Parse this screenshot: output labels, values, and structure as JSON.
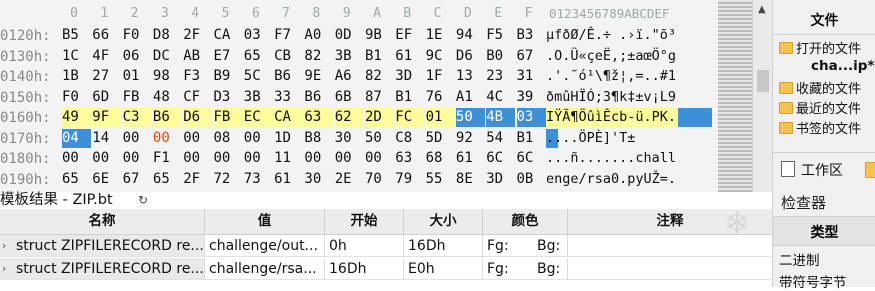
{
  "hex_editor": {
    "column_headers": [
      "0",
      "1",
      "2",
      "3",
      "4",
      "5",
      "6",
      "7",
      "8",
      "9",
      "A",
      "B",
      "C",
      "D",
      "E",
      "F"
    ],
    "ascii_header": "0123456789ABCDEF",
    "rows": [
      {
        "addr": "0120h:",
        "bytes": [
          "B5",
          "66",
          "F0",
          "D8",
          "2F",
          "CA",
          "03",
          "F7",
          "A0",
          "0D",
          "9B",
          "EF",
          "1E",
          "94",
          "F5",
          "B3"
        ],
        "ascii": "µfðØ/Ê.÷ .›ï.\"õ³",
        "style": "normal"
      },
      {
        "addr": "0130h:",
        "bytes": [
          "1C",
          "4F",
          "06",
          "DC",
          "AB",
          "E7",
          "65",
          "CB",
          "82",
          "3B",
          "B1",
          "61",
          "9C",
          "D6",
          "B0",
          "67"
        ],
        "ascii": ".O.Ü«çeË‚;±aœÖ°g",
        "style": "normal"
      },
      {
        "addr": "0140h:",
        "bytes": [
          "1B",
          "27",
          "01",
          "98",
          "F3",
          "B9",
          "5C",
          "B6",
          "9E",
          "A6",
          "82",
          "3D",
          "1F",
          "13",
          "23",
          "31"
        ],
        "ascii": ".'.˜ó¹\\¶ž¦‚=..#1",
        "style": "normal"
      },
      {
        "addr": "0150h:",
        "bytes": [
          "F0",
          "6D",
          "FB",
          "48",
          "CF",
          "D3",
          "3B",
          "33",
          "B6",
          "6B",
          "87",
          "B1",
          "76",
          "A1",
          "4C",
          "39"
        ],
        "ascii": "ðmûHÏÓ;3¶k‡±v¡L9",
        "style": "normal"
      },
      {
        "addr": "0160h:",
        "bytes": [
          "49",
          "9F",
          "C3",
          "B6",
          "D6",
          "FB",
          "EC",
          "CA",
          "63",
          "62",
          "2D",
          "FC",
          "01",
          "50",
          "4B",
          "03"
        ],
        "ascii": "IŸÃ¶ÖûìÊcb-ü.PK.",
        "style": "yellow"
      },
      {
        "addr": "0170h:",
        "bytes": [
          "04",
          "14",
          "00",
          "00",
          "00",
          "08",
          "00",
          "1D",
          "B8",
          "30",
          "50",
          "C8",
          "5D",
          "92",
          "54",
          "B1"
        ],
        "ascii": "....ÖPÈ]'T±",
        "style": "selstart"
      },
      {
        "addr": "0180h:",
        "bytes": [
          "00",
          "00",
          "00",
          "F1",
          "00",
          "00",
          "00",
          "11",
          "00",
          "00",
          "00",
          "63",
          "68",
          "61",
          "6C",
          "6C"
        ],
        "ascii": "...ñ.......chall",
        "style": "normal"
      },
      {
        "addr": "0190h:",
        "bytes": [
          "65",
          "6E",
          "67",
          "65",
          "2F",
          "72",
          "73",
          "61",
          "30",
          "2E",
          "70",
          "79",
          "55",
          "8E",
          "3D",
          "0B"
        ],
        "ascii": "enge/rsa0.pyUŽ=.",
        "style": "normal"
      }
    ]
  },
  "right_panel": {
    "title": "文件",
    "items": [
      "打开的文件",
      "收藏的文件",
      "最近的文件",
      "书签的文件"
    ],
    "open_file_name": "cha...ip*",
    "workspace_label": "工作区",
    "inspector_label": "检查器",
    "type_header": "类型",
    "type_rows": [
      "二进制",
      "带符号字节"
    ]
  },
  "template_results": {
    "title": "模板结果 - ZIP.bt",
    "columns": [
      "名称",
      "值",
      "开始",
      "大小",
      "颜色",
      "注释"
    ],
    "rows": [
      {
        "name": "struct ZIPFILERECORD re...",
        "value": "challenge/out...",
        "start": "0h",
        "size": "16Dh",
        "fg": "Fg:",
        "bg": "Bg:"
      },
      {
        "name": "struct ZIPFILERECORD re...",
        "value": "challenge/rsa...",
        "start": "16Dh",
        "size": "E0h",
        "fg": "Fg:",
        "bg": "Bg:"
      }
    ]
  }
}
